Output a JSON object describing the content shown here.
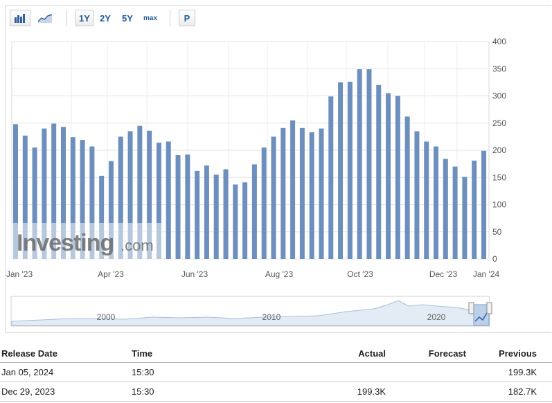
{
  "toolbar": {
    "buttons": [
      {
        "label": "",
        "icon": "bar-chart-icon"
      },
      {
        "label": "",
        "icon": "line-chart-icon"
      },
      {
        "label": "1Y"
      },
      {
        "label": "2Y"
      },
      {
        "label": "5Y"
      },
      {
        "label": "max"
      },
      {
        "label": "P"
      }
    ]
  },
  "watermark": {
    "main": "Investing",
    "suffix": ".com"
  },
  "chart_data": {
    "type": "bar",
    "title": "",
    "xlabel": "",
    "ylabel": "",
    "ylim": [
      0,
      400
    ],
    "yticks": [
      0,
      50,
      100,
      150,
      200,
      250,
      300,
      350,
      400
    ],
    "y_axis_position": "right",
    "grid": true,
    "bar_color": "#6c8fbd",
    "x_tick_labels": [
      "Jan '23",
      "Apr '23",
      "Jun '23",
      "Aug '23",
      "Oct '23",
      "Dec '23",
      "Jan '24"
    ],
    "values": [
      248,
      227,
      205,
      240,
      249,
      243,
      224,
      219,
      207,
      153,
      180,
      225,
      235,
      245,
      236,
      214,
      216,
      191,
      192,
      162,
      172,
      155,
      165,
      137,
      141,
      174,
      205,
      225,
      241,
      255,
      241,
      233,
      240,
      299,
      325,
      326,
      349,
      349,
      320,
      305,
      300,
      262,
      235,
      216,
      207,
      184,
      170,
      151,
      181,
      199
    ]
  },
  "navigator": {
    "labels": [
      "2000",
      "2010",
      "2020"
    ]
  },
  "table": {
    "headers": {
      "release_date": "Release Date",
      "time": "Time",
      "actual": "Actual",
      "forecast": "Forecast",
      "previous": "Previous"
    },
    "rows": [
      {
        "release_date": "Jan 05, 2024",
        "time": "15:30",
        "actual": "",
        "forecast": "",
        "previous": "199.3K"
      },
      {
        "release_date": "Dec 29, 2023",
        "time": "15:30",
        "actual": "199.3K",
        "forecast": "",
        "previous": "182.7K"
      }
    ]
  }
}
